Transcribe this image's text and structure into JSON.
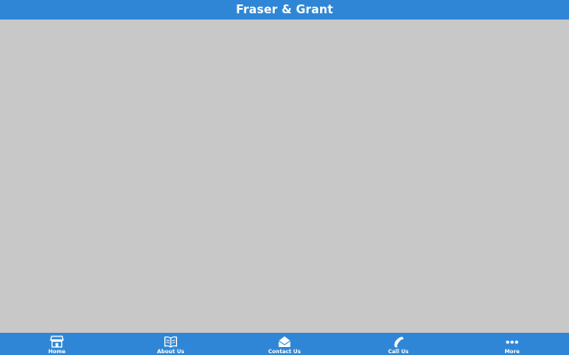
{
  "app": {
    "title": "Fraser & Grant"
  },
  "colors": {
    "bar": "#2f86d6",
    "content": "#c8c8c8",
    "text": "#ffffff"
  },
  "tabs": [
    {
      "label": "Home",
      "icon": "store-icon"
    },
    {
      "label": "About Us",
      "icon": "book-icon"
    },
    {
      "label": "Contact Us",
      "icon": "envelope-icon"
    },
    {
      "label": "Call Us",
      "icon": "phone-icon"
    },
    {
      "label": "More",
      "icon": "more-dots-icon"
    }
  ]
}
